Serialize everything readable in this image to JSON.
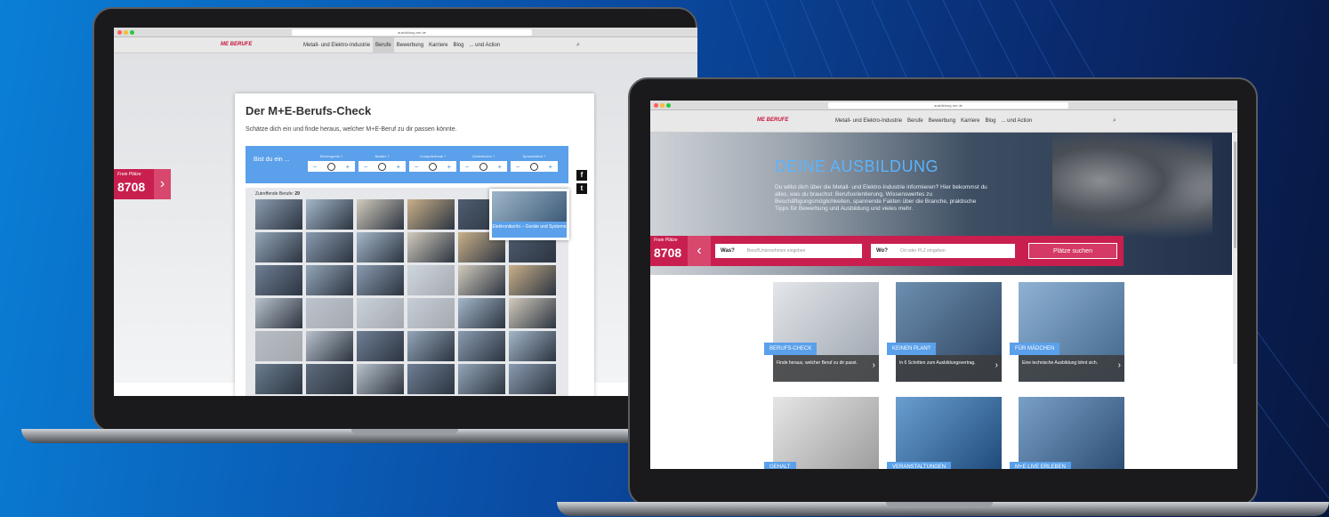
{
  "left": {
    "url": "ausbildung-me.de",
    "logo": "ME BERUFE",
    "nav": [
      "Metall- und Elektro-Industrie",
      "Berufe",
      "Bewerbung",
      "Karriere",
      "Blog",
      "... und Action"
    ],
    "title": "Der M+E-Berufs-Check",
    "subtitle": "Schätze dich ein und finde heraus, welcher M+E-Beruf zu dir passen könnte.",
    "bist": "Bist du ein ...",
    "filters": [
      "Elektrogenie ?",
      "Bastler ?",
      "Computerfreak ?",
      "Zahlenfuchs ?",
      "Sprachtalent ?"
    ],
    "count_label": "Zutreffende Berufe:",
    "count": "29",
    "tooltip": "Elektroniker/in – Geräte und Systeme",
    "frei_label": "Freie Plätze",
    "frei_count": "8708"
  },
  "right": {
    "url": "ausbildung-me.de",
    "logo": "ME BERUFE",
    "nav": [
      "Metall- und Elektro-Industrie",
      "Berufe",
      "Bewerbung",
      "Karriere",
      "Blog",
      "... und Action"
    ],
    "hero_title": "DEINE AUSBILDUNG",
    "hero_text": "Du willst dich über die Metall- und Elektro-Industrie informieren? Hier bekommst du alles, was du brauchst: Berufsorientierung, Wissenswertes zu Beschäftigungsmöglichkeiten, spannende Fakten über die Branche, praktische Tipps für Bewerbung und Ausbildung und vieles mehr.",
    "frei_label": "Freie Plätze",
    "frei_count": "8708",
    "was_label": "Was?",
    "was_placeholder": "Beruf/Unternehmen eingeben",
    "wo_label": "Wo?",
    "wo_placeholder": "Ort oder PLZ eingeben",
    "search_button": "Plätze suchen",
    "cards": [
      {
        "label": "BERUFS-CHECK",
        "desc": "Finde heraus, welcher Beruf zu dir passt."
      },
      {
        "label": "KEINEN PLAN?",
        "desc": "In 6 Schritten zum Ausbildungsvertrag."
      },
      {
        "label": "FÜR MÄDCHEN",
        "desc": "Eine technische Ausbildung lohnt sich."
      }
    ],
    "bottom_cards": [
      "GEHALT",
      "VERANSTALTUNGEN",
      "M+E LIVE ERLEBEN"
    ]
  },
  "colors": {
    "accent_blue": "#5aa0ea",
    "brand_red": "#c81f4e"
  }
}
